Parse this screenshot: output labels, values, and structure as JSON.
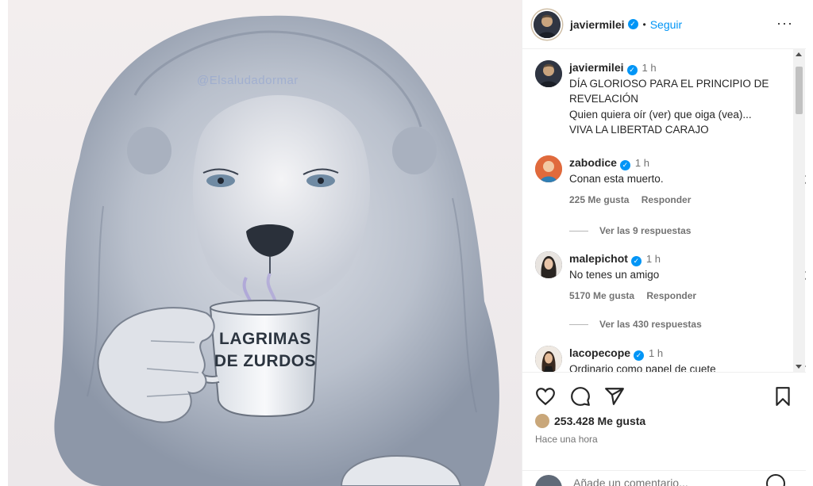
{
  "image": {
    "watermark": "@Elsaludadormar",
    "mug_line1": "LAGRIMAS",
    "mug_line2": "DE ZURDOS"
  },
  "header": {
    "username": "javiermilei",
    "separator": "•",
    "follow_label": "Seguir",
    "more_label": "···"
  },
  "caption": {
    "username": "javiermilei",
    "time": "1 h",
    "lines": [
      "DÍA GLORIOSO PARA EL PRINCIPIO DE REVELACIÓN",
      "Quien quiera oír (ver) que oiga (vea)...",
      "VIVA LA LIBERTAD CARAJO"
    ]
  },
  "comments": [
    {
      "username": "zabodice",
      "time": "1 h",
      "text": "Conan esta muerto.",
      "likes": "225 Me gusta",
      "reply_label": "Responder",
      "replies_label": "Ver las 9 respuestas"
    },
    {
      "username": "malepichot",
      "time": "1 h",
      "text": "No tenes un amigo",
      "likes": "5170 Me gusta",
      "reply_label": "Responder",
      "replies_label": "Ver las 430 respuestas"
    },
    {
      "username": "lacopecope",
      "time": "1 h",
      "text": "Ordinario como papel de cuete"
    }
  ],
  "actions": {
    "likes": "253.428 Me gusta",
    "time_ago": "Hace una hora"
  },
  "add_comment": {
    "placeholder": "Añade un comentario..."
  },
  "colors": {
    "accent": "#0095f6",
    "text": "#262626",
    "muted": "#737373"
  }
}
